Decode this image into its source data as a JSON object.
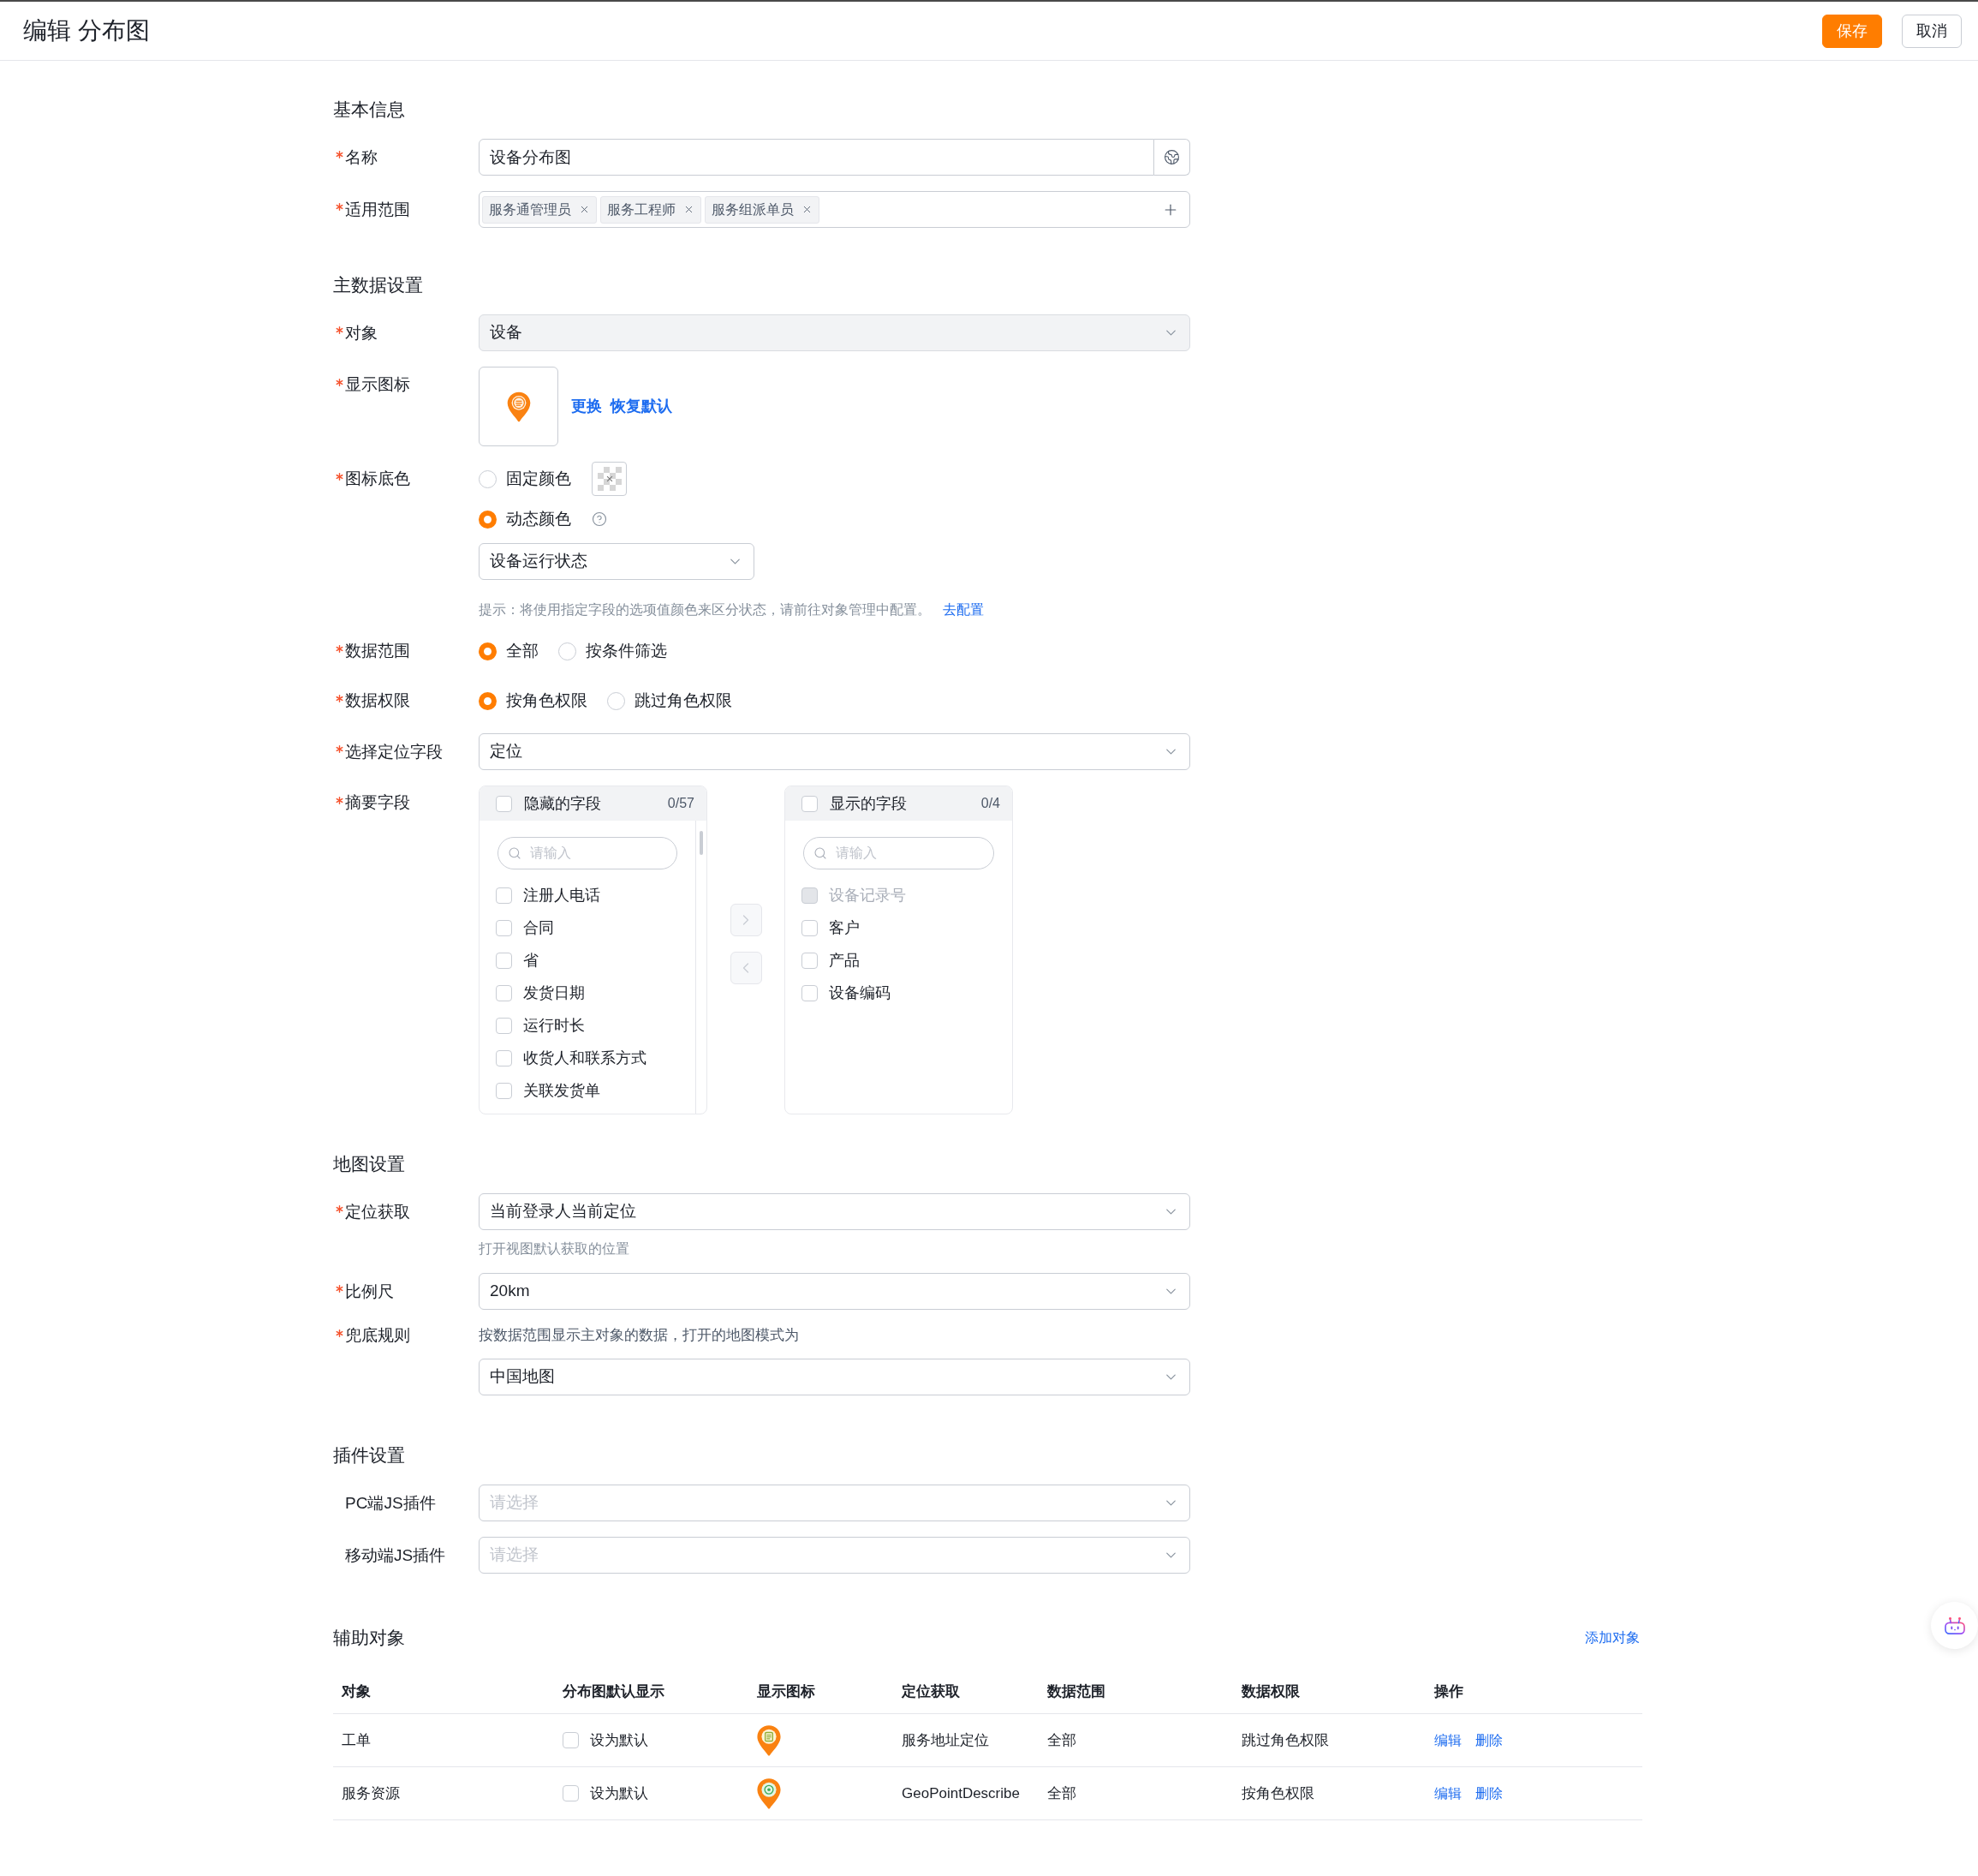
{
  "header": {
    "title": "编辑 分布图",
    "buttons": [
      {
        "label": "保存",
        "kind": "primary"
      },
      {
        "label": "取消",
        "kind": "default"
      }
    ]
  },
  "basic_info": {
    "title": "基本信息",
    "fields": [
      {
        "kind": "text",
        "label": "名称",
        "required": true,
        "value": "设备分布图"
      },
      {
        "kind": "tags",
        "label": "适用范围",
        "required": true,
        "tags": [
          "服务通管理员",
          "服务工程师",
          "服务组派单员"
        ]
      }
    ]
  },
  "main_data": {
    "title": "主数据设置",
    "fields": [
      {
        "kind": "select",
        "label": "对象",
        "required": true,
        "value": "设备",
        "disabled": true
      },
      {
        "kind": "icon",
        "label": "显示图标",
        "required": true,
        "links": [
          "更换",
          "恢复默认"
        ]
      },
      {
        "kind": "icon_color",
        "label": "图标底色",
        "required": true,
        "options": [
          {
            "label": "固定颜色",
            "selected": false,
            "kind": "swatch"
          },
          {
            "label": "动态颜色",
            "selected": true,
            "kind": "help"
          }
        ],
        "select": {
          "value": "设备运行状态"
        },
        "tip": "提示：将使用指定字段的选项值颜色来区分状态，请前往对象管理中配置。",
        "tip_link": "去配置"
      },
      {
        "kind": "radio",
        "label": "数据范围",
        "required": true,
        "options": [
          {
            "label": "全部",
            "selected": true
          },
          {
            "label": "按条件筛选",
            "selected": false
          }
        ]
      },
      {
        "kind": "radio",
        "label": "数据权限",
        "required": true,
        "options": [
          {
            "label": "按角色权限",
            "selected": true
          },
          {
            "label": "跳过角色权限",
            "selected": false
          }
        ]
      },
      {
        "kind": "select",
        "label": "选择定位字段",
        "required": true,
        "value": "定位",
        "disabled": false
      },
      {
        "kind": "transfer",
        "label": "摘要字段",
        "required": true,
        "panels": [
          {
            "title": "隐藏的字段",
            "count": "0/57",
            "checked": false,
            "search_placeholder": "请输入",
            "items": [
              {
                "label": "注册人电话",
                "checked": false,
                "disabled": false
              },
              {
                "label": "合同",
                "checked": false,
                "disabled": false
              },
              {
                "label": "省",
                "checked": false,
                "disabled": false
              },
              {
                "label": "发货日期",
                "checked": false,
                "disabled": false
              },
              {
                "label": "运行时长",
                "checked": false,
                "disabled": false
              },
              {
                "label": "收货人和联系方式",
                "checked": false,
                "disabled": false
              },
              {
                "label": "关联发货单",
                "checked": false,
                "disabled": false
              }
            ]
          },
          {
            "title": "显示的字段",
            "count": "0/4",
            "checked": false,
            "search_placeholder": "请输入",
            "items": [
              {
                "label": "设备记录号",
                "checked": false,
                "disabled": true
              },
              {
                "label": "客户",
                "checked": false,
                "disabled": false
              },
              {
                "label": "产品",
                "checked": false,
                "disabled": false
              },
              {
                "label": "设备编码",
                "checked": false,
                "disabled": false
              }
            ]
          }
        ],
        "buttons": [
          {
            "kind": "right",
            "disabled": true
          },
          {
            "kind": "left",
            "disabled": true
          }
        ]
      }
    ]
  },
  "map_settings": {
    "title": "地图设置",
    "fields": [
      {
        "kind": "select",
        "label": "定位获取",
        "required": true,
        "value": "当前登录人当前定位",
        "disabled": false,
        "hint": "打开视图默认获取的位置"
      },
      {
        "kind": "select",
        "label": "比例尺",
        "required": true,
        "value": "20km",
        "disabled": false
      },
      {
        "kind": "select",
        "label": "兜底规则",
        "required": true,
        "description": "按数据范围显示主对象的数据，打开的地图模式为",
        "value": "中国地图",
        "disabled": false
      }
    ]
  },
  "plugin_settings": {
    "title": "插件设置",
    "fields": [
      {
        "kind": "select",
        "label": "PC端JS插件",
        "required": false,
        "placeholder": "请选择",
        "disabled": false
      },
      {
        "kind": "select",
        "label": "移动端JS插件",
        "required": false,
        "placeholder": "请选择",
        "disabled": false
      }
    ]
  },
  "auxiliary": {
    "title": "辅助对象",
    "add_link": "添加对象",
    "table": {
      "columns": [
        "对象",
        "分布图默认显示",
        "显示图标",
        "定位获取",
        "数据范围",
        "数据权限",
        "操作"
      ],
      "rows": [
        {
          "object": "工单",
          "default": {
            "label": "设为默认",
            "checked": false
          },
          "kind": "document",
          "location": "服务地址定位",
          "data_scope": "全部",
          "permission": "跳过角色权限",
          "actions": [
            "编辑",
            "删除"
          ]
        },
        {
          "object": "服务资源",
          "default": {
            "label": "设为默认",
            "checked": false
          },
          "kind": "target",
          "location": "GeoPointDescribe",
          "data_scope": "全部",
          "permission": "按角色权限",
          "actions": [
            "编辑",
            "删除"
          ]
        }
      ]
    }
  }
}
